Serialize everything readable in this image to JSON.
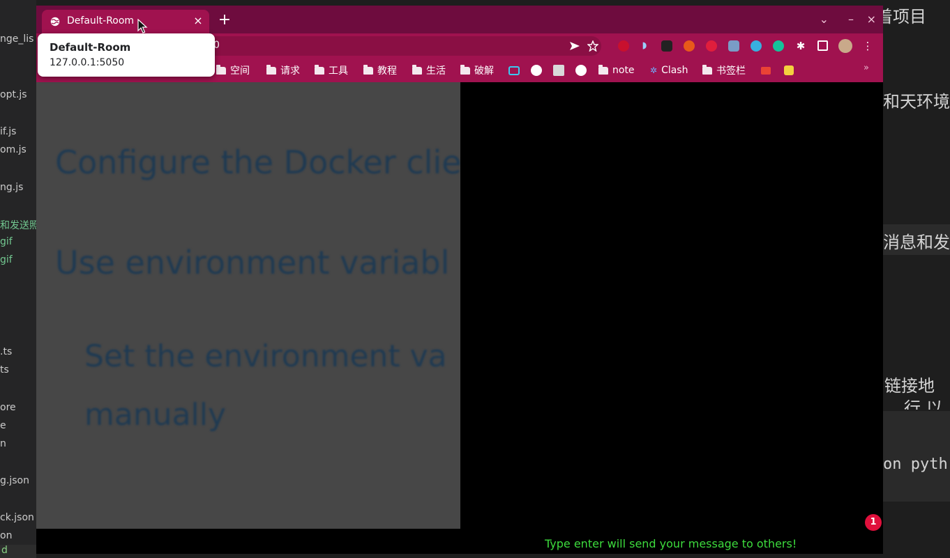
{
  "background_editor": {
    "sidebar_files": [
      "nge_lis",
      "opt.js",
      "if.js",
      "om.js",
      "ng.js",
      "和发送照",
      "gif",
      "gif",
      ".ts",
      "ts",
      "ore",
      "e",
      "n",
      "g.json",
      "ck.json",
      "on",
      "d"
    ],
    "right_text": [
      "着项目",
      "和天环境",
      "消息和发",
      "链接地",
      "行 以",
      "on pyth"
    ],
    "status_char": "d"
  },
  "browser": {
    "tab": {
      "title": "Default-Room",
      "close_glyph": "×"
    },
    "new_tab_glyph": "+",
    "window_controls": {
      "dropdown": "⌄",
      "minimize": "–",
      "close": "×"
    },
    "address": {
      "url_fragment": "0"
    },
    "bookmarks": [
      {
        "label": "空间",
        "type": "folder"
      },
      {
        "label": "请求",
        "type": "folder"
      },
      {
        "label": "工具",
        "type": "folder"
      },
      {
        "label": "教程",
        "type": "folder"
      },
      {
        "label": "生活",
        "type": "folder"
      },
      {
        "label": "破解",
        "type": "folder"
      },
      {
        "label": "note",
        "type": "folder"
      },
      {
        "label": "Clash",
        "type": "site"
      },
      {
        "label": "书签栏",
        "type": "folder"
      }
    ],
    "bookmarks_more": "»",
    "accent_colors": {
      "tabbar": "#6e0c3e",
      "toolbar": "#a0124f"
    }
  },
  "hovercard": {
    "title": "Default-Room",
    "address": "127.0.0.1:5050"
  },
  "doc": {
    "heading_1": "Configure the Docker clie",
    "heading_2": "Use environment variabl",
    "heading_3_line1": "Set the environment va",
    "heading_3_line2": "manually"
  },
  "chat": {
    "hint": "Type enter will send your message to others!",
    "notification_count": "1"
  }
}
